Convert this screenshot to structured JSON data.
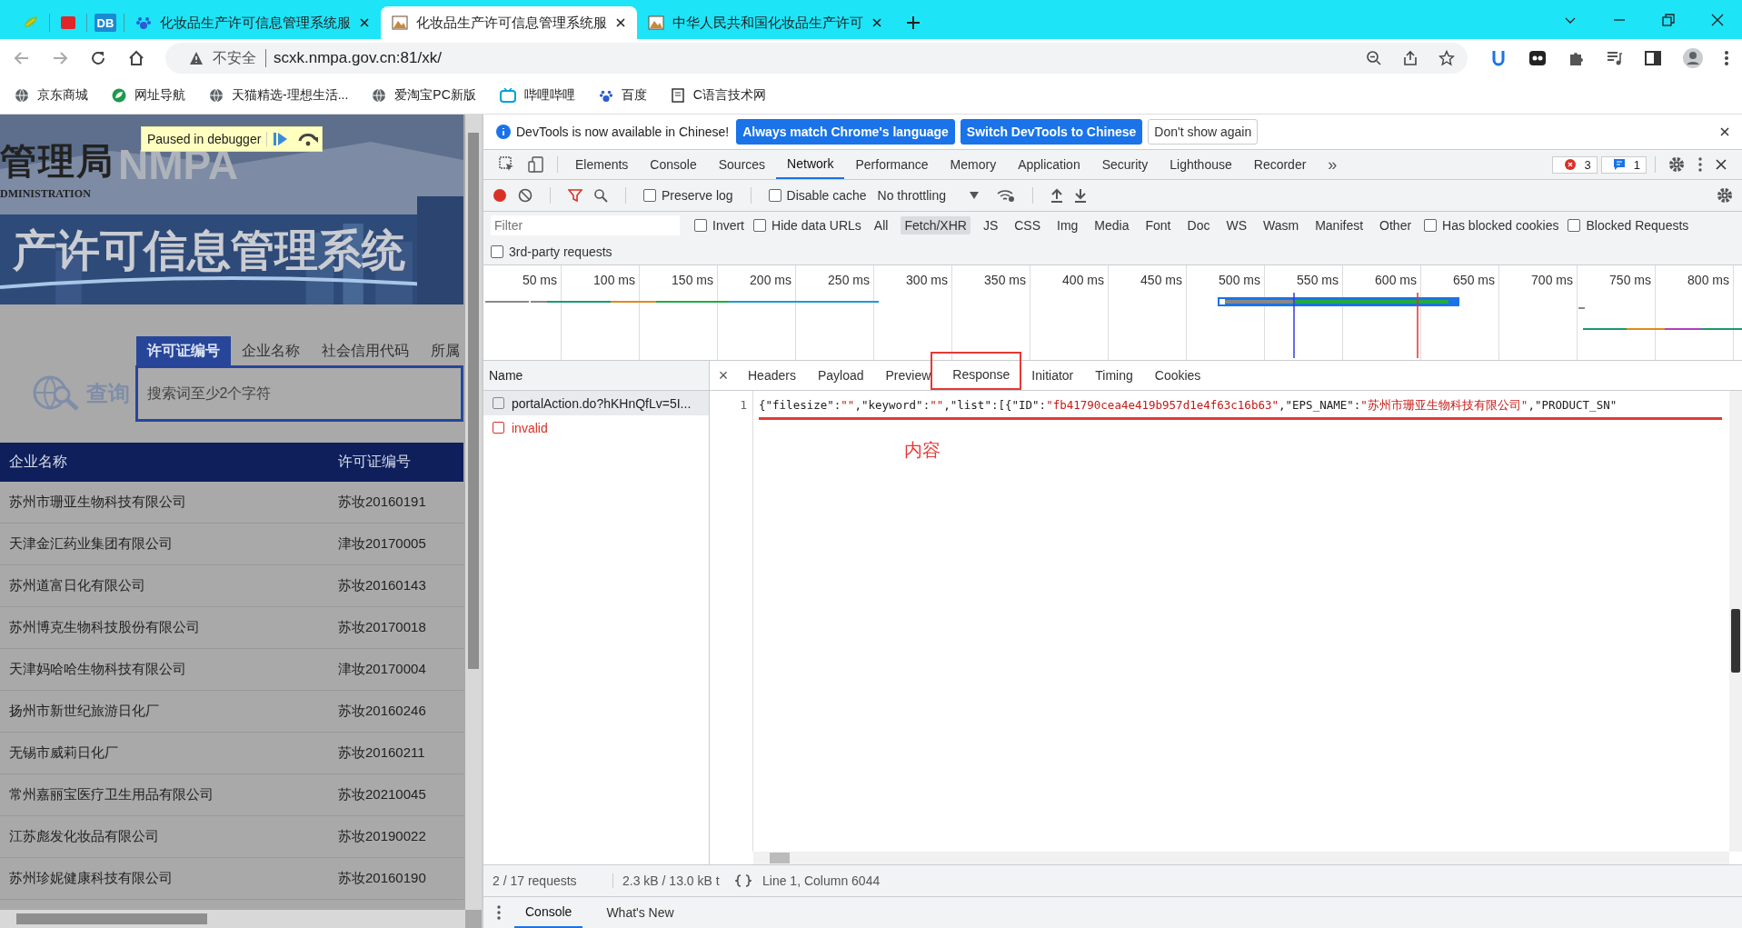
{
  "browser": {
    "pinned": [
      {
        "kind": "leaf"
      },
      {
        "kind": "book"
      },
      {
        "kind": "db",
        "label": "DB"
      }
    ],
    "tabs": [
      {
        "title": "化妆品生产许可信息管理系统服",
        "kind": "paw",
        "selected": false
      },
      {
        "title": "化妆品生产许可信息管理系统服",
        "kind": "picture",
        "selected": true
      },
      {
        "title": "中华人民共和国化妆品生产许可",
        "kind": "picture",
        "selected": false
      }
    ],
    "address": {
      "security": "不安全",
      "url": "scxk.nmpa.gov.cn:81/xk/"
    },
    "bookmarks": [
      {
        "label": "京东商城",
        "kind": "globe"
      },
      {
        "label": "网址导航",
        "kind": "leaf"
      },
      {
        "label": "天猫精选-理想生活...",
        "kind": "globe"
      },
      {
        "label": "爱淘宝PC新版",
        "kind": "globe"
      },
      {
        "label": "哔哩哔哩",
        "kind": "tv"
      },
      {
        "label": "百度",
        "kind": "paw"
      },
      {
        "label": "C语言技术网",
        "kind": "book"
      }
    ]
  },
  "page": {
    "paused": "Paused in debugger",
    "banner": {
      "agency": "管理局",
      "logo": "NMPA",
      "agency_en": "DMINISTRATION",
      "title": "产许可信息管理系统"
    },
    "search_tabs": [
      {
        "label": "许可证编号",
        "selected": true
      },
      {
        "label": "企业名称",
        "selected": false
      },
      {
        "label": "社会信用代码",
        "selected": false
      },
      {
        "label": "所属",
        "selected": false
      }
    ],
    "search_button": "查询",
    "search": {
      "placeholder": "搜索词至少2个字符"
    },
    "table": {
      "columns": [
        "企业名称",
        "许可证编号"
      ],
      "rows": [
        [
          "苏州市珊亚生物科技有限公司",
          "苏妆20160191"
        ],
        [
          "天津金汇药业集团有限公司",
          "津妆20170005"
        ],
        [
          "苏州道富日化有限公司",
          "苏妆20160143"
        ],
        [
          "苏州博克生物科技股份有限公司",
          "苏妆20170018"
        ],
        [
          "天津妈哈哈生物科技有限公司",
          "津妆20170004"
        ],
        [
          "扬州市新世纪旅游日化厂",
          "苏妆20160246"
        ],
        [
          "无锡市威莉日化厂",
          "苏妆20160211"
        ],
        [
          "常州嘉丽宝医疗卫生用品有限公司",
          "苏妆20210045"
        ],
        [
          "江苏彪发化妆品有限公司",
          "苏妆20190022"
        ],
        [
          "苏州珍妮健康科技有限公司",
          "苏妆20160190"
        ]
      ]
    }
  },
  "devtools": {
    "infobar": {
      "message": "DevTools is now available in Chinese!",
      "buttons": [
        {
          "label": "Always match Chrome's language",
          "kind": "primary"
        },
        {
          "label": "Switch DevTools to Chinese",
          "kind": "primary"
        },
        {
          "label": "Don't show again",
          "kind": "plain"
        }
      ]
    },
    "tabs": [
      {
        "label": "Elements",
        "selected": false
      },
      {
        "label": "Console",
        "selected": false
      },
      {
        "label": "Sources",
        "selected": false
      },
      {
        "label": "Network",
        "selected": true
      },
      {
        "label": "Performance",
        "selected": false
      },
      {
        "label": "Memory",
        "selected": false
      },
      {
        "label": "Application",
        "selected": false
      },
      {
        "label": "Security",
        "selected": false
      },
      {
        "label": "Lighthouse",
        "selected": false
      },
      {
        "label": "Recorder",
        "selected": false
      }
    ],
    "more": "»",
    "errors": "3",
    "messages": "1",
    "toolbar": {
      "preserve_log": {
        "label": "Preserve log",
        "checked": false
      },
      "disable_cache": {
        "label": "Disable cache",
        "checked": false
      },
      "throttling": "No throttling"
    },
    "filter": {
      "placeholder": "Filter",
      "invert": {
        "label": "Invert",
        "checked": false
      },
      "hide_data_urls": {
        "label": "Hide data URLs",
        "checked": false
      },
      "types": [
        {
          "label": "All",
          "selected": false
        },
        {
          "label": "Fetch/XHR",
          "selected": true
        },
        {
          "label": "JS",
          "selected": false
        },
        {
          "label": "CSS",
          "selected": false
        },
        {
          "label": "Img",
          "selected": false
        },
        {
          "label": "Media",
          "selected": false
        },
        {
          "label": "Font",
          "selected": false
        },
        {
          "label": "Doc",
          "selected": false
        },
        {
          "label": "WS",
          "selected": false
        },
        {
          "label": "Wasm",
          "selected": false
        },
        {
          "label": "Manifest",
          "selected": false
        },
        {
          "label": "Other",
          "selected": false
        }
      ],
      "blocked_cookies": {
        "label": "Has blocked cookies",
        "checked": false
      },
      "blocked_requests": {
        "label": "Blocked Requests",
        "checked": false
      },
      "third_party": {
        "label": "3rd-party requests",
        "checked": false
      }
    },
    "timeline_ticks": [
      "50 ms",
      "100 ms",
      "150 ms",
      "200 ms",
      "250 ms",
      "300 ms",
      "350 ms",
      "400 ms",
      "450 ms",
      "500 ms",
      "550 ms",
      "600 ms",
      "650 ms",
      "700 ms",
      "750 ms",
      "800 ms"
    ],
    "requests": {
      "column": "Name",
      "rows": [
        {
          "name": "portalAction.do?hKHnQfLv=5I...",
          "kind": "ok"
        },
        {
          "name": "invalid",
          "kind": "error"
        }
      ]
    },
    "detail_tabs": [
      {
        "label": "Headers",
        "selected": false
      },
      {
        "label": "Payload",
        "selected": false
      },
      {
        "label": "Preview",
        "selected": false
      },
      {
        "label": "Response",
        "selected": true
      },
      {
        "label": "Initiator",
        "selected": false
      },
      {
        "label": "Timing",
        "selected": false
      },
      {
        "label": "Cookies",
        "selected": false
      }
    ],
    "close": "×",
    "response": {
      "line_number": "1",
      "tokens": [
        {
          "text": "{\"filesize\":",
          "kind": "punct"
        },
        {
          "text": "\"\"",
          "kind": "string"
        },
        {
          "text": ",\"keyword\":",
          "kind": "punct"
        },
        {
          "text": "\"\"",
          "kind": "string"
        },
        {
          "text": ",\"list\":[{\"ID\":",
          "kind": "punct"
        },
        {
          "text": "\"fb41790cea4e419b957d1e4f63c16b63\"",
          "kind": "string"
        },
        {
          "text": ",\"EPS_NAME\":",
          "kind": "punct"
        },
        {
          "text": "\"苏州市珊亚生物科技有限公司\"",
          "kind": "string"
        },
        {
          "text": ",\"PRODUCT_SN\"",
          "kind": "punct"
        }
      ]
    },
    "annotation": "内容",
    "status": {
      "requests": "2 / 17 requests",
      "transferred": "2.3 kB / 13.0 kB t",
      "position": "Line 1, Column 6044"
    },
    "drawer_tabs": [
      {
        "label": "Console",
        "selected": true
      },
      {
        "label": "What's New",
        "selected": false
      }
    ]
  }
}
